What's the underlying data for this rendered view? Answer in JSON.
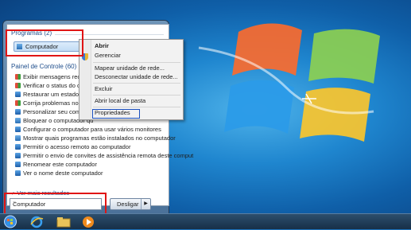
{
  "start_menu": {
    "programs_header": "Programas (2)",
    "computer_item": "Computador",
    "control_panel_header": "Painel de Controle (60)",
    "control_panel_items": [
      "Exibir mensagens recentes s",
      "Verificar o status do comput",
      "Restaurar um estado anteri",
      "Corrija problemas no comp",
      "Personalizar seu computad",
      "Bloquear o computador qu",
      "Configurar o computador para usar vários monitores",
      "Mostrar quais programas estão instalados no computador",
      "Permitir o acesso remoto ao computador",
      "Permitir o envio de convites de assistência remota deste comput",
      "Renomear este computador",
      "Ver o nome deste computador"
    ],
    "more_results": "Ver mais resultados",
    "search_value": "Computador",
    "search_clear": "×",
    "shutdown_label": "Desligar",
    "shutdown_arrow": "▶"
  },
  "context_menu": {
    "items": [
      "Abrir",
      "Gerenciar",
      "Mapear unidade de rede...",
      "Desconectar unidade de rede...",
      "Excluir",
      "Abrir local de pasta",
      "Propriedades"
    ]
  },
  "icons": {
    "taskbar": [
      "start-orb-icon",
      "internet-explorer-icon",
      "folder-icon",
      "media-player-icon"
    ],
    "context_first": "shield-icon"
  },
  "colors": {
    "highlight_red": "#e01414",
    "selection_blue": "#1a4fbf",
    "link_blue": "#1f4e8c"
  }
}
